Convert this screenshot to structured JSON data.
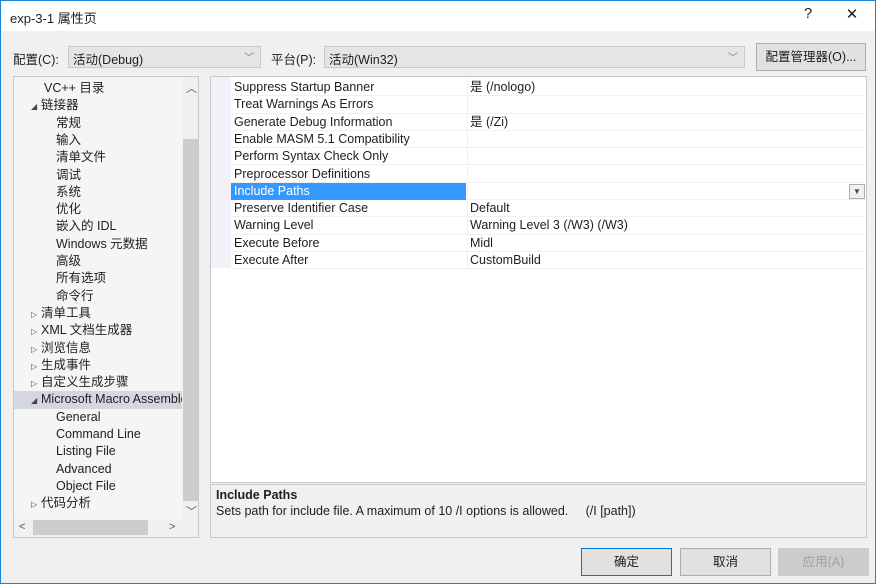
{
  "window": {
    "title": "exp-3-1 属性页",
    "help": "?",
    "close": "✕"
  },
  "config": {
    "label": "配置(C):",
    "value": "活动(Debug)",
    "platform_label": "平台(P):",
    "platform_value": "活动(Win32)",
    "manager_button": "配置管理器(O)..."
  },
  "tree": {
    "items": [
      {
        "label": "VC++ 目录",
        "level": 1,
        "expander": ""
      },
      {
        "label": "链接器",
        "level": 1,
        "expander": "expanded"
      },
      {
        "label": "常规",
        "level": 2,
        "expander": ""
      },
      {
        "label": "输入",
        "level": 2,
        "expander": ""
      },
      {
        "label": "清单文件",
        "level": 2,
        "expander": ""
      },
      {
        "label": "调试",
        "level": 2,
        "expander": ""
      },
      {
        "label": "系统",
        "level": 2,
        "expander": ""
      },
      {
        "label": "优化",
        "level": 2,
        "expander": ""
      },
      {
        "label": "嵌入的 IDL",
        "level": 2,
        "expander": ""
      },
      {
        "label": "Windows 元数据",
        "level": 2,
        "expander": ""
      },
      {
        "label": "高级",
        "level": 2,
        "expander": ""
      },
      {
        "label": "所有选项",
        "level": 2,
        "expander": ""
      },
      {
        "label": "命令行",
        "level": 2,
        "expander": ""
      },
      {
        "label": "清单工具",
        "level": 1,
        "expander": "collapsed"
      },
      {
        "label": "XML 文档生成器",
        "level": 1,
        "expander": "collapsed"
      },
      {
        "label": "浏览信息",
        "level": 1,
        "expander": "collapsed"
      },
      {
        "label": "生成事件",
        "level": 1,
        "expander": "collapsed"
      },
      {
        "label": "自定义生成步骤",
        "level": 1,
        "expander": "collapsed"
      },
      {
        "label": "Microsoft Macro Assembler",
        "level": 1,
        "expander": "expanded",
        "selected": true
      },
      {
        "label": "General",
        "level": 2,
        "expander": ""
      },
      {
        "label": "Command Line",
        "level": 2,
        "expander": ""
      },
      {
        "label": "Listing File",
        "level": 2,
        "expander": ""
      },
      {
        "label": "Advanced",
        "level": 2,
        "expander": ""
      },
      {
        "label": "Object File",
        "level": 2,
        "expander": ""
      },
      {
        "label": "代码分析",
        "level": 1,
        "expander": "collapsed"
      }
    ]
  },
  "grid": {
    "rows": [
      {
        "name": "Suppress Startup Banner",
        "value": "是 (/nologo)"
      },
      {
        "name": "Treat Warnings As Errors",
        "value": ""
      },
      {
        "name": "Generate Debug Information",
        "value": "是 (/Zi)"
      },
      {
        "name": "Enable MASM 5.1 Compatibility",
        "value": ""
      },
      {
        "name": "Perform Syntax Check Only",
        "value": ""
      },
      {
        "name": "Preprocessor Definitions",
        "value": ""
      },
      {
        "name": "Include Paths",
        "value": "",
        "selected": true
      },
      {
        "name": "Preserve Identifier Case",
        "value": "Default"
      },
      {
        "name": "Warning Level",
        "value": "Warning Level 3 (/W3) (/W3)"
      },
      {
        "name": "Execute Before",
        "value": "Midl"
      },
      {
        "name": "Execute After",
        "value": "CustomBuild"
      }
    ]
  },
  "description": {
    "title": "Include Paths",
    "text": "Sets path for include file. A maximum of 10 /I options is allowed.     (/I [path])"
  },
  "buttons": {
    "ok": "确定",
    "cancel": "取消",
    "apply": "应用(A)"
  },
  "colors": {
    "accent": "#3399ff",
    "border": "#1883d7",
    "tree_selected": "#d4d7e0"
  }
}
